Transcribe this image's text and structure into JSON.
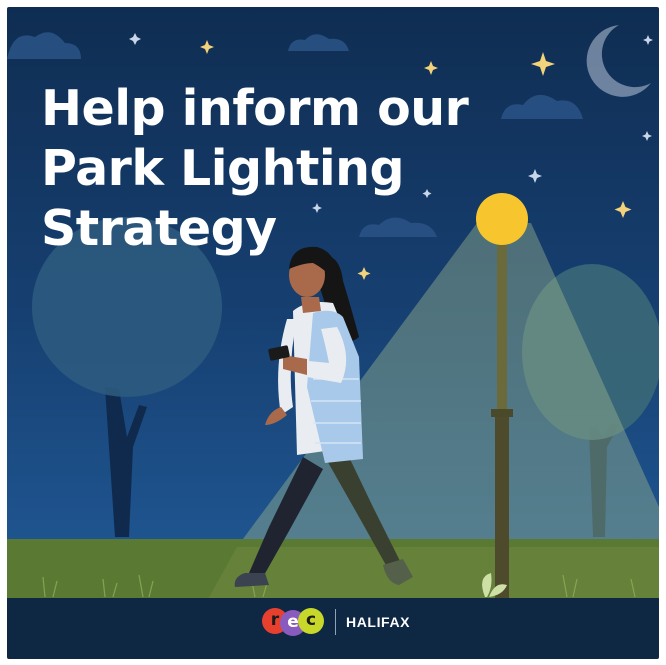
{
  "headline": {
    "line1": "Help inform our",
    "line2": "Park Lighting",
    "line3": "Strategy"
  },
  "footer": {
    "logo_letters": [
      "r",
      "e",
      "c"
    ],
    "logo_colors": [
      "#e8402f",
      "#8a5bbf",
      "#c7d82b"
    ],
    "partner_name": "HALIFAX"
  },
  "colors": {
    "sky_top": "#0f2d52",
    "sky_bottom": "#1d4f88",
    "grass": "#5a7a34",
    "lamp_glow": "#f7c62f",
    "footer_bg": "#0e2843"
  },
  "icons": [
    "moon-icon",
    "star-icon",
    "cloud-icon",
    "street-lamp-icon",
    "tree-icon",
    "walking-person-icon",
    "phone-icon",
    "sprout-icon"
  ]
}
